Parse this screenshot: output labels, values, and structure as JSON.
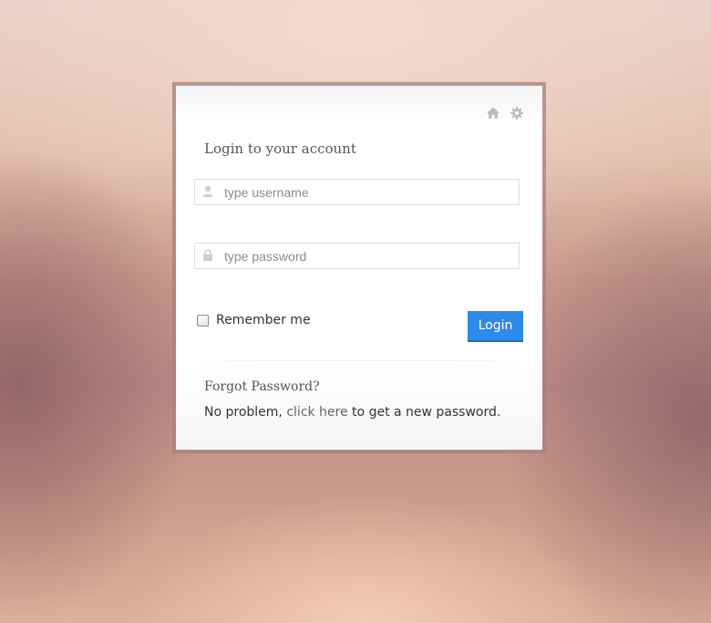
{
  "login_card": {
    "title": "Login to your account",
    "top_icons": [
      "home-icon",
      "gear-icon"
    ],
    "username": {
      "icon": "user-icon",
      "placeholder": "type username",
      "value": ""
    },
    "password": {
      "icon": "lock-icon",
      "placeholder": "type password",
      "value": ""
    },
    "remember": {
      "label": "Remember me",
      "checked": false
    },
    "login_button_label": "Login",
    "forgot": {
      "title": "Forgot Password?",
      "text_before": "No problem, ",
      "link_text": "click here",
      "text_after": " to get a new password."
    }
  },
  "colors": {
    "accent": "#2d8ae6",
    "card_border": "#a8807c",
    "text": "#333333",
    "placeholder": "#8c8c8c"
  }
}
